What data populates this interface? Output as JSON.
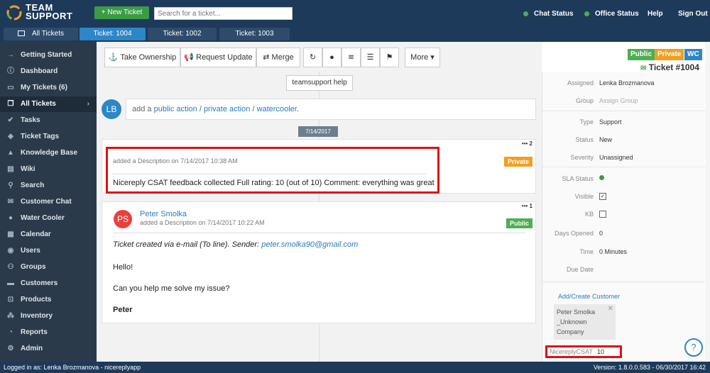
{
  "app": {
    "logo_line1": "TEAM",
    "logo_line2": "SUPPORT",
    "new_ticket_label": "+ New Ticket",
    "search_placeholder": "Search for a ticket...",
    "chat_status": "Chat Status",
    "office_status": "Office Status",
    "help": "Help",
    "sign_out": "Sign Out",
    "accent_color": "#2d86c5",
    "status_green": "#4caf50"
  },
  "tabs": [
    {
      "label": "All Tickets",
      "icon": "window-icon"
    },
    {
      "label": "Ticket: 1004"
    },
    {
      "label": "Ticket: 1002"
    },
    {
      "label": "Ticket: 1003"
    }
  ],
  "sidebar": {
    "items": [
      {
        "label": "Getting Started",
        "icon": "arrow-right-icon"
      },
      {
        "label": "Dashboard",
        "icon": "info-circle-icon"
      },
      {
        "label": "My Tickets (6)",
        "icon": "monitor-icon"
      },
      {
        "label": "All Tickets",
        "icon": "window-icon"
      },
      {
        "label": "Tasks",
        "icon": "checkmark-icon"
      },
      {
        "label": "Ticket Tags",
        "icon": "tag-icon"
      },
      {
        "label": "Knowledge Base",
        "icon": "graduation-icon"
      },
      {
        "label": "Wiki",
        "icon": "book-icon"
      },
      {
        "label": "Search",
        "icon": "search-icon"
      },
      {
        "label": "Customer Chat",
        "icon": "chat-icon"
      },
      {
        "label": "Water Cooler",
        "icon": "drop-icon"
      },
      {
        "label": "Calendar",
        "icon": "calendar-icon"
      },
      {
        "label": "Users",
        "icon": "user-circle-icon"
      },
      {
        "label": "Groups",
        "icon": "group-icon"
      },
      {
        "label": "Customers",
        "icon": "building-icon"
      },
      {
        "label": "Products",
        "icon": "cart-icon"
      },
      {
        "label": "Inventory",
        "icon": "network-icon"
      },
      {
        "label": "Reports",
        "icon": "pie-icon"
      },
      {
        "label": "Admin",
        "icon": "gear-icon"
      }
    ]
  },
  "toolbar": {
    "take_ownership": "Take Ownership",
    "request_update": "Request Update",
    "merge": "Merge",
    "more": "More"
  },
  "timeline": {
    "help_button": "teamsupport help",
    "current_user_initials": "LB",
    "action_prefix": "add a",
    "public_action": "public action",
    "private_action": "private action",
    "watercooler": "watercooler",
    "separator": "/",
    "period": ".",
    "date_label": "7/14/2017",
    "actions": [
      {
        "number": "2",
        "meta": "added a Description on 7/14/2017 10:38 AM",
        "badge": "Private",
        "badge_color": "#f0a020",
        "body": "Nicereply CSAT feedback collected Full rating: 10 (out of 10) Comment: everything was great"
      },
      {
        "number": "1",
        "author": "Peter Smolka",
        "author_initials": "PS",
        "meta": "added a Description on 7/14/2017 10:22 AM",
        "badge": "Public",
        "badge_color": "#4caf50",
        "body_line1_prefix": "Ticket created via e-mail (To line). Sender:",
        "body_line1_email": "peter.smolka90@gmail.com",
        "body_line2": "Hello!",
        "body_line3": "Can you help me solve my issue?",
        "signature": "Peter"
      }
    ]
  },
  "ticket": {
    "tags": [
      {
        "label": "Public",
        "color": "#4caf50"
      },
      {
        "label": "Private",
        "color": "#f0a020"
      },
      {
        "label": "WC",
        "color": "#2d86c5"
      }
    ],
    "title": "Ticket #1004",
    "properties": {
      "assigned_label": "Assigned",
      "assigned_value": "Lenka Brozmanova",
      "group_label": "Group",
      "group_value": "Assign Group",
      "type_label": "Type",
      "type_value": "Support",
      "status_label": "Status",
      "status_value": "New",
      "severity_label": "Severity",
      "severity_value": "Unassigned",
      "sla_label": "SLA Status",
      "visible_label": "Visible",
      "visible_checked": true,
      "kb_label": "KB",
      "kb_checked": false,
      "days_opened_label": "Days Opened",
      "days_opened_value": "0",
      "time_label": "Time",
      "time_value": "0 Minutes",
      "due_date_label": "Due Date",
      "add_customer": "Add/Create Customer",
      "customer_name": "Peter Smolka",
      "customer_company_line1": "_Unknown",
      "customer_company_line2": "Company",
      "nicereply_label": "NicereplyCSAT",
      "nicereply_value": "10"
    }
  },
  "status_bar": {
    "logged_in": "Logged in as: Lenka Brozmanova - nicereplyapp",
    "version": "Version: 1.8.0.0.583 - 06/30/2017 16:42"
  }
}
